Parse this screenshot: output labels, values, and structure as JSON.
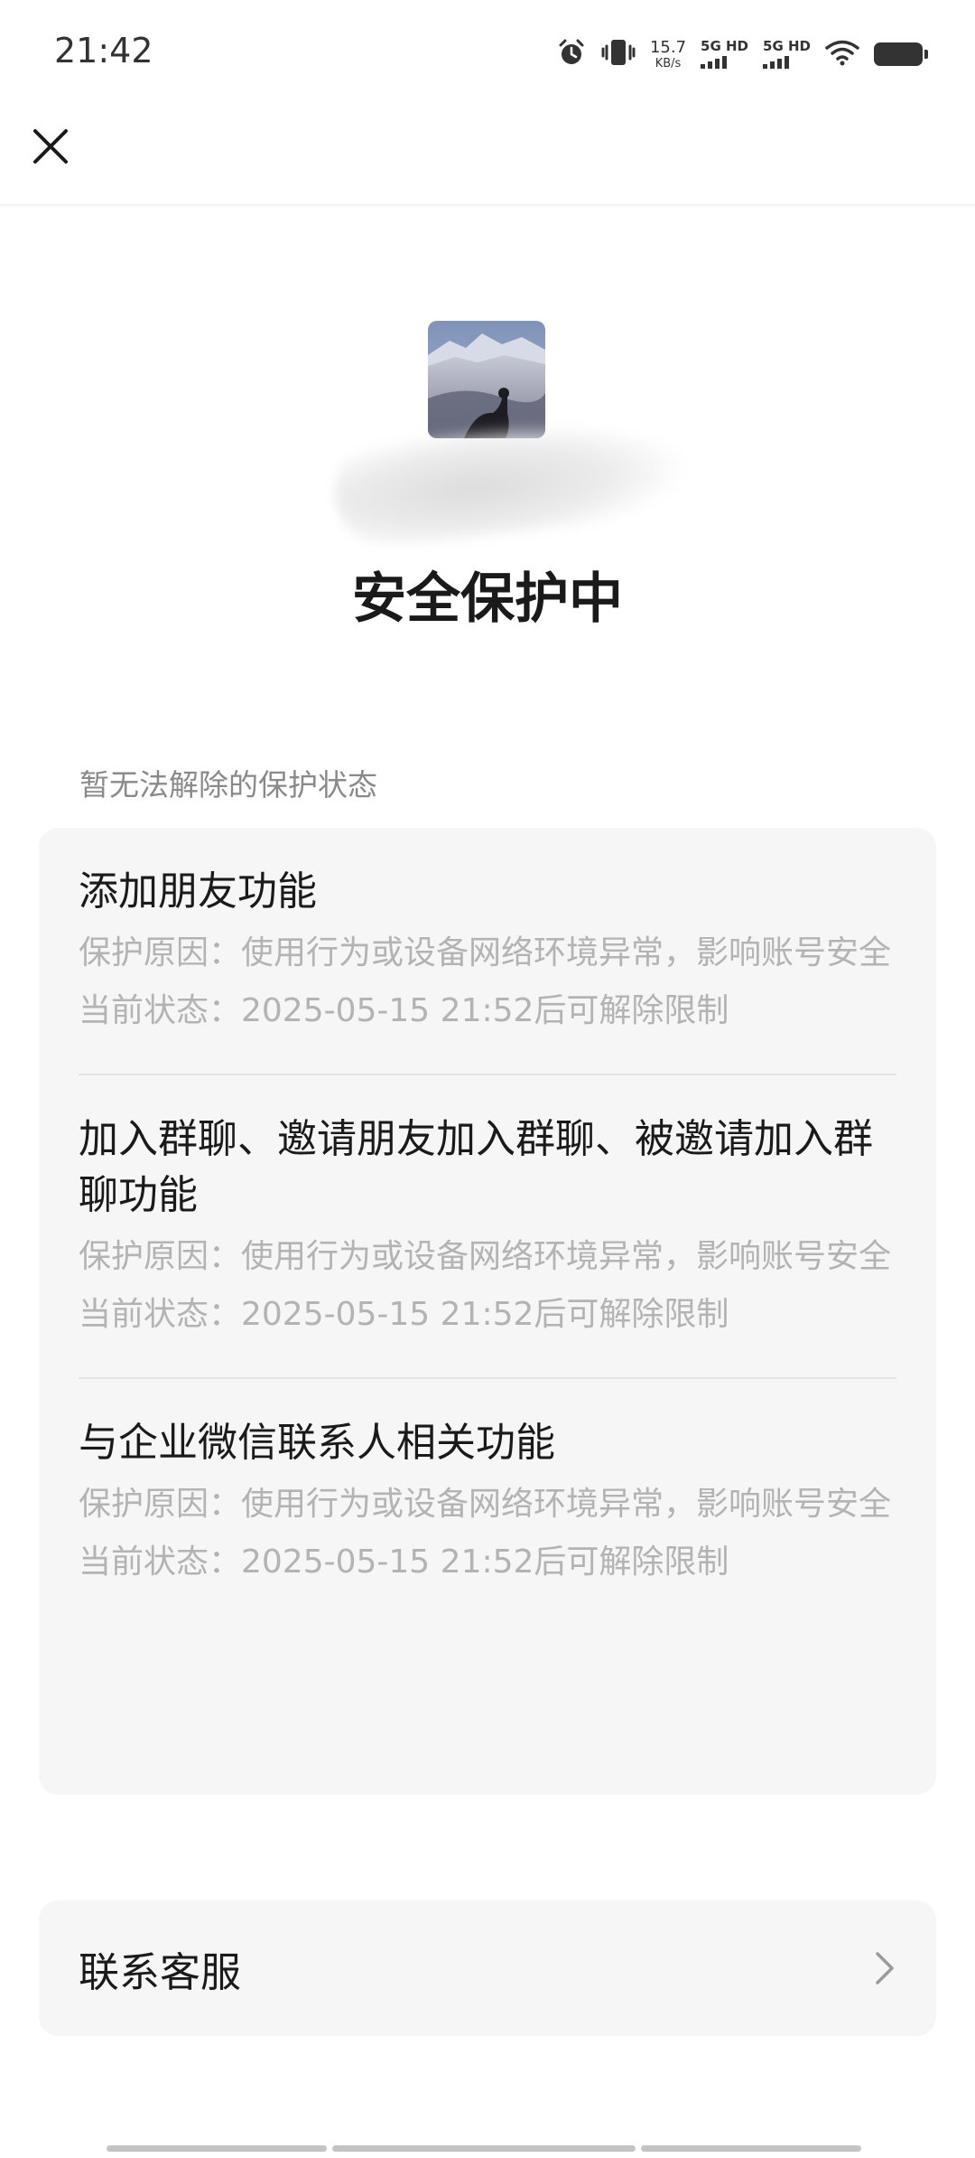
{
  "status_bar": {
    "time": "21:42",
    "net_speed_value": "15.7",
    "net_speed_unit": "KB/s",
    "signal_1_label": "5G HD",
    "signal_2_label": "5G HD",
    "icons": [
      "alarm-icon",
      "vibrate-icon",
      "signal-icon",
      "wifi-icon",
      "battery-icon"
    ]
  },
  "nav": {
    "close_icon": "close-icon"
  },
  "hero": {
    "title": "安全保护中"
  },
  "section": {
    "label": "暂无法解除的保护状态"
  },
  "items": [
    {
      "title": "添加朋友功能",
      "reason": "保护原因：使用行为或设备网络环境异常，影响账号安全",
      "status": "当前状态：2025-05-15 21:52后可解除限制"
    },
    {
      "title": "加入群聊、邀请朋友加入群聊、被邀请加入群聊功能",
      "reason": "保护原因：使用行为或设备网络环境异常，影响账号安全",
      "status": "当前状态：2025-05-15 21:52后可解除限制"
    },
    {
      "title": "与企业微信联系人相关功能",
      "reason": "保护原因：使用行为或设备网络环境异常，影响账号安全",
      "status": "当前状态：2025-05-15 21:52后可解除限制"
    }
  ],
  "contact": {
    "label": "联系客服",
    "icon": "chevron-right-icon"
  },
  "colors": {
    "card_bg": "#f6f6f6",
    "muted_text": "#b3b3b3",
    "label_text": "#8a8a8a",
    "title_text": "#1a1a1a"
  }
}
